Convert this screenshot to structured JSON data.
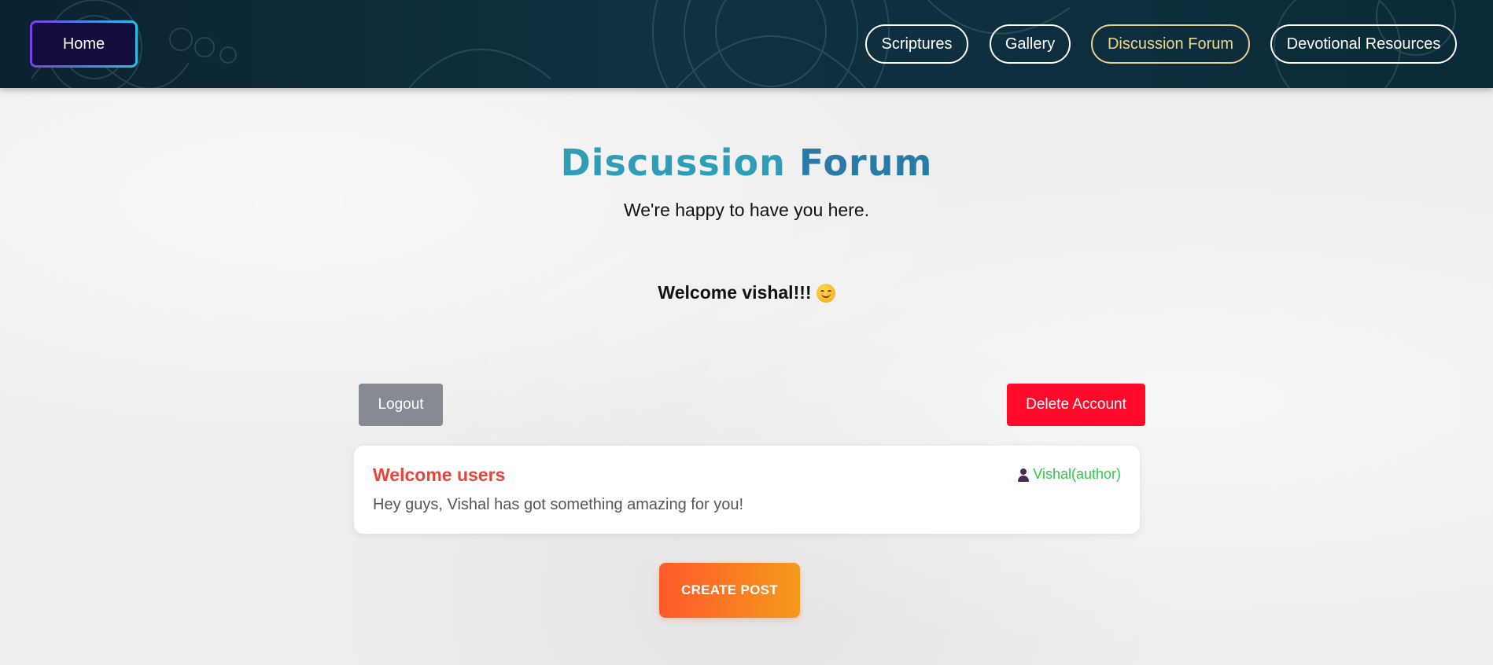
{
  "nav": {
    "home_label": "Home",
    "links": [
      {
        "label": "Scriptures",
        "active": false
      },
      {
        "label": "Gallery",
        "active": false
      },
      {
        "label": "Discussion Forum",
        "active": true
      },
      {
        "label": "Devotional Resources",
        "active": false
      }
    ]
  },
  "header": {
    "title_part1": "Discussion",
    "title_part2": "Forum",
    "subtitle": "We're happy to have you here."
  },
  "welcome": {
    "text": "Welcome vishal!!!",
    "emoji_icon": "smiling-face-icon"
  },
  "actions": {
    "logout_label": "Logout",
    "delete_label": "Delete Account"
  },
  "posts": [
    {
      "title": "Welcome users",
      "author": "Vishal(author)",
      "body": "Hey guys, Vishal has got something amazing for you!"
    }
  ],
  "create_post_label": "CREATE POST",
  "colors": {
    "nav_bg": "#0f3240",
    "title": "#2e8fb6",
    "logout": "#868a91",
    "delete": "#ff0a2a",
    "post_title": "#e8443a",
    "author": "#2ec94a",
    "active_nav": "#f0d68a",
    "create_start": "#ff5a2a",
    "create_end": "#f59a1c"
  }
}
